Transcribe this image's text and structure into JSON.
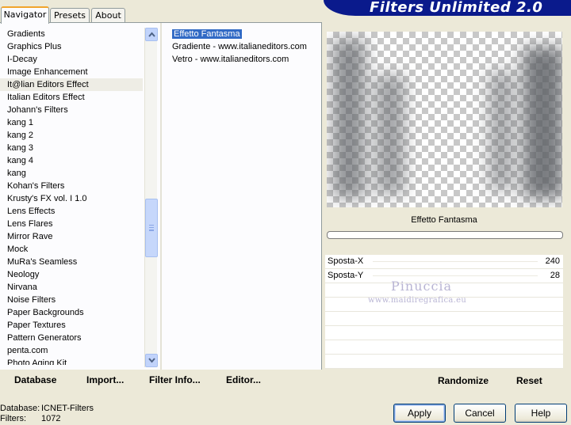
{
  "app": {
    "title": "Filters Unlimited 2.0"
  },
  "tabs": [
    {
      "label": "Navigator",
      "active": true
    },
    {
      "label": "Presets",
      "active": false
    },
    {
      "label": "About",
      "active": false
    }
  ],
  "categories": [
    "Gradients",
    "Graphics Plus",
    "I-Decay",
    "Image Enhancement",
    "It@lian Editors Effect",
    "Italian Editors Effect",
    "Johann's Filters",
    "kang 1",
    "kang 2",
    "kang 3",
    "kang 4",
    "kang",
    "Kohan's Filters",
    "Krusty's FX vol. I 1.0",
    "Lens Effects",
    "Lens Flares",
    "Mirror Rave",
    "Mock",
    "MuRa's Seamless",
    "Neology",
    "Nirvana",
    "Noise Filters",
    "Paper Backgrounds",
    "Paper Textures",
    "Pattern Generators",
    "penta.com",
    "Photo Aging Kit"
  ],
  "selected_category": "It@lian Editors Effect",
  "filters": [
    "Effetto Fantasma",
    "Gradiente - www.italianeditors.com",
    "Vetro - www.italianeditors.com"
  ],
  "selected_filter": "Effetto Fantasma",
  "preview": {
    "filter_name": "Effetto Fantasma"
  },
  "params": [
    {
      "label": "Sposta-X",
      "value": "240"
    },
    {
      "label": "Sposta-Y",
      "value": "28"
    }
  ],
  "watermark": {
    "line1": "Pinuccia",
    "line2": "www.maidiregrafica.eu"
  },
  "bottom_buttons": {
    "database": "Database",
    "import": "Import...",
    "filter_info": "Filter Info...",
    "editor": "Editor...",
    "randomize": "Randomize",
    "reset": "Reset"
  },
  "status": {
    "database_label": "Database:",
    "database_value": "ICNET-Filters",
    "filters_label": "Filters:",
    "filters_value": "1072"
  },
  "dialog_buttons": {
    "apply": "Apply",
    "cancel": "Cancel",
    "help": "Help"
  },
  "colors": {
    "banner": "#0a1a8c",
    "selection": "#316ac5",
    "accent_tab": "#f1a42c"
  }
}
